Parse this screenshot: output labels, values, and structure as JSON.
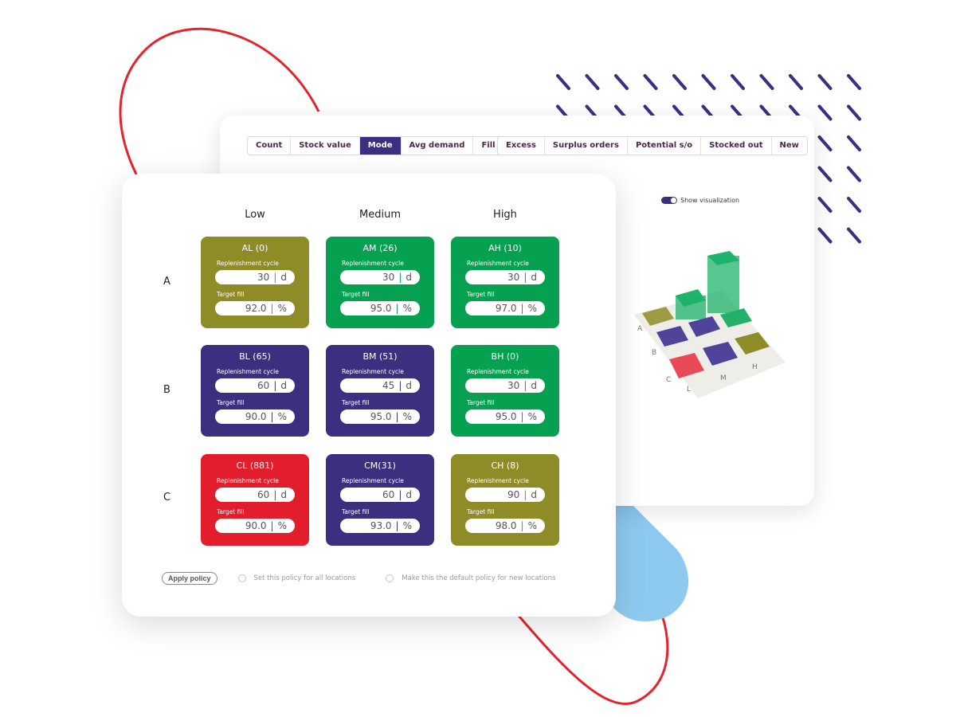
{
  "colors": {
    "olive": "#8e8c27",
    "green": "#05a050",
    "purple": "#3c2f80",
    "red": "#e31e2c",
    "decor_red": "#e3242e",
    "decor_blue": "#8ecaf0",
    "decor_dash": "#3c2f80"
  },
  "metric_tabs": [
    {
      "label": "Count",
      "active": false
    },
    {
      "label": "Stock value",
      "active": false
    },
    {
      "label": "Mode",
      "active": true
    },
    {
      "label": "Avg demand",
      "active": false
    },
    {
      "label": "Fill",
      "active": false
    }
  ],
  "status_tabs": [
    {
      "label": "Excess"
    },
    {
      "label": "Surplus orders"
    },
    {
      "label": "Potential s/o"
    },
    {
      "label": "Stocked out"
    },
    {
      "label": "New"
    }
  ],
  "visualization": {
    "toggle_label": "Show visualization",
    "enabled": true,
    "row_labels": [
      "A",
      "B",
      "C"
    ],
    "col_labels": [
      "L",
      "M",
      "H"
    ]
  },
  "matrix": {
    "columns": [
      "Low",
      "Medium",
      "High"
    ],
    "rows": [
      "A",
      "B",
      "C"
    ],
    "cycle_label": "Replenishment cycle",
    "fill_label": "Target fill",
    "cycle_unit": "d",
    "fill_unit": "%",
    "cells": [
      {
        "title": "AL (0)",
        "color": "olive",
        "cycle": "30",
        "fill": "92.0"
      },
      {
        "title": "AM (26)",
        "color": "green",
        "cycle": "30",
        "fill": "95.0"
      },
      {
        "title": "AH (10)",
        "color": "green",
        "cycle": "30",
        "fill": "97.0"
      },
      {
        "title": "BL (65)",
        "color": "purple",
        "cycle": "60",
        "fill": "90.0"
      },
      {
        "title": "BM (51)",
        "color": "purple",
        "cycle": "45",
        "fill": "95.0"
      },
      {
        "title": "BH (0)",
        "color": "green",
        "cycle": "30",
        "fill": "95.0"
      },
      {
        "title": "CL (881)",
        "color": "red",
        "cycle": "60",
        "fill": "90.0"
      },
      {
        "title": "CM(31)",
        "color": "purple",
        "cycle": "60",
        "fill": "93.0"
      },
      {
        "title": "CH (8)",
        "color": "olive",
        "cycle": "90",
        "fill": "98.0"
      }
    ]
  },
  "footer": {
    "apply_label": "Apply policy",
    "option_all_locations": "Set this policy for all locations",
    "option_default_new": "Make this the default policy for new locations"
  }
}
